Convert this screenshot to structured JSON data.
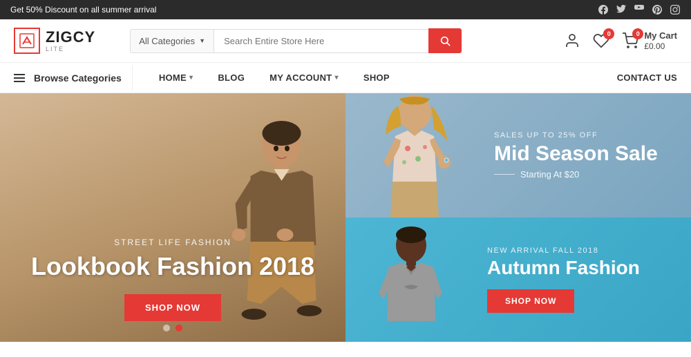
{
  "announcement": {
    "text": "Get 50% Discount on all summer arrival"
  },
  "social": {
    "icons": [
      "facebook",
      "twitter",
      "youtube",
      "pinterest",
      "instagram"
    ]
  },
  "logo": {
    "name": "ZIGCY",
    "sub": "LITE"
  },
  "search": {
    "category_label": "All Categories",
    "placeholder": "Search Entire Store Here"
  },
  "navigation": {
    "browse": "Browse Categories",
    "items": [
      {
        "label": "HOME",
        "has_dropdown": true
      },
      {
        "label": "BLOG",
        "has_dropdown": false
      },
      {
        "label": "MY ACCOUNT",
        "has_dropdown": true
      },
      {
        "label": "SHOP",
        "has_dropdown": false
      },
      {
        "label": "CONTACT US",
        "has_dropdown": false
      }
    ]
  },
  "cart": {
    "label": "My Cart",
    "amount": "£0.00",
    "count": "0"
  },
  "hero_left": {
    "subtitle": "STREET LIFE FASHION",
    "title": "Lookbook Fashion 2018",
    "cta": "SHOP NOW"
  },
  "hero_right_top": {
    "tag": "SALES UP TO 25% OFF",
    "title": "Mid Season Sale",
    "subline": "Starting At $20"
  },
  "hero_right_bottom": {
    "tag": "NEW ARRIVAL FALL 2018",
    "title": "Autumn Fashion",
    "cta": "SHOP NOW"
  }
}
